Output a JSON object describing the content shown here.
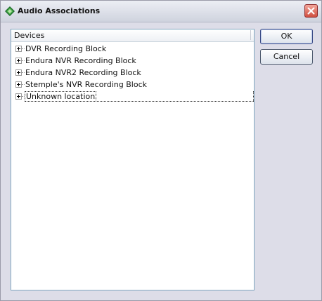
{
  "window": {
    "title": "Audio Associations",
    "icon": "diamond-app-icon",
    "close_icon": "close-icon"
  },
  "tree": {
    "header": "Devices",
    "items": [
      {
        "label": "DVR Recording Block",
        "expanded": false
      },
      {
        "label": "Endura NVR Recording Block",
        "expanded": false
      },
      {
        "label": "Endura NVR2 Recording Block",
        "expanded": false
      },
      {
        "label": "Stemple's NVR Recording Block",
        "expanded": false
      },
      {
        "label": "Unknown location",
        "expanded": false,
        "focused": true
      }
    ]
  },
  "buttons": {
    "ok": "OK",
    "cancel": "Cancel"
  },
  "colors": {
    "accent_green": "#2f8f3a",
    "close_red": "#cf4f40",
    "panel_border": "#7fa6bf"
  }
}
